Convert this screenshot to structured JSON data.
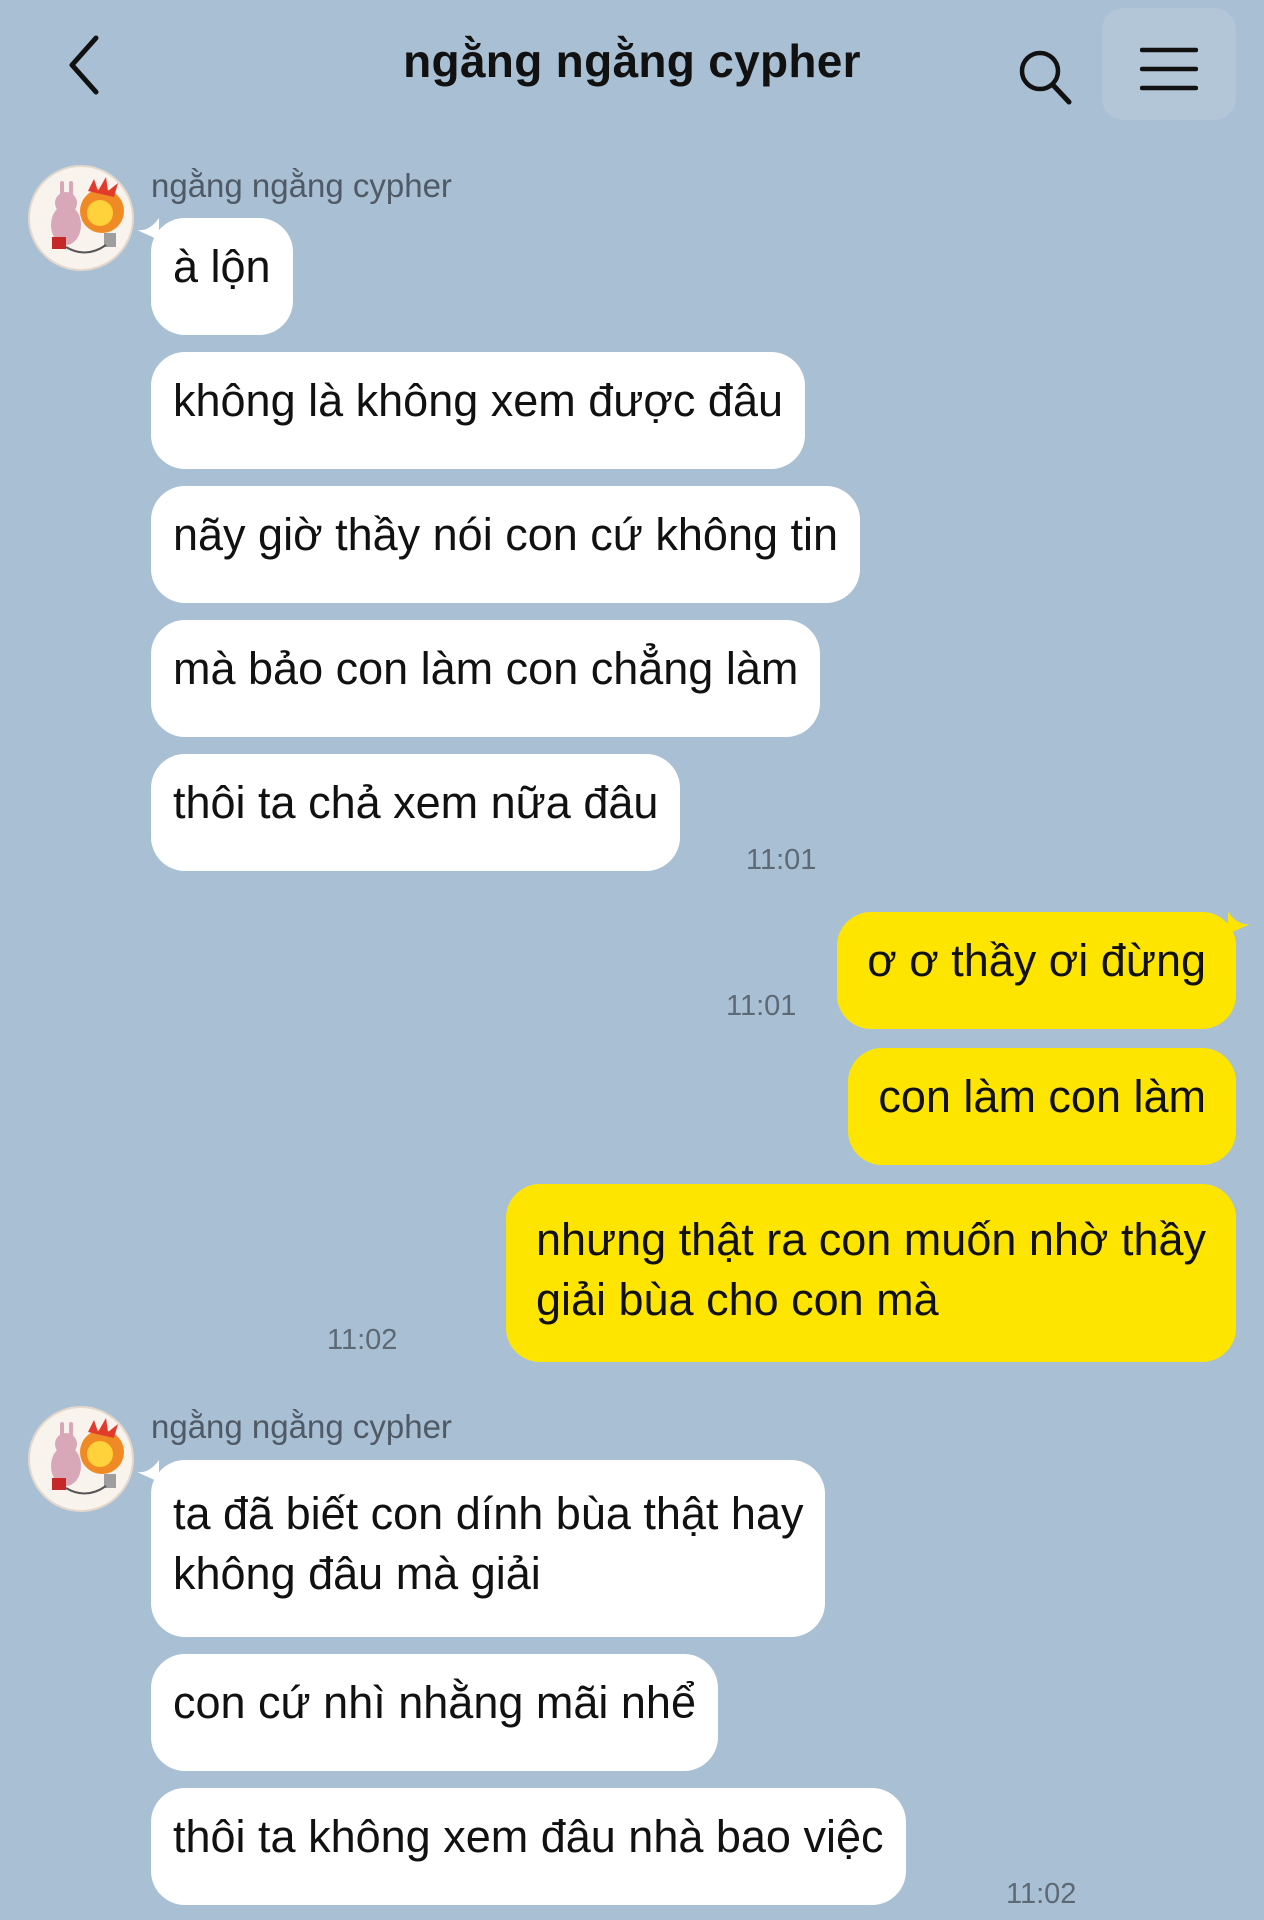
{
  "header": {
    "title": "ngằng ngằng cypher",
    "back_icon": "chevron-left-icon",
    "search_icon": "search-icon",
    "menu_icon": "hamburger-menu-icon"
  },
  "colors": {
    "background": "#a9c0d4",
    "incoming_bubble": "#ffffff",
    "outgoing_bubble": "#fee500"
  },
  "groups": [
    {
      "sender": "ngằng ngằng cypher",
      "messages": [
        "à lộn",
        "không là không xem được đâu",
        "nãy giờ thầy nói con cứ không tin",
        "mà bảo con làm con chẳng làm",
        "thôi ta chả xem nữa đâu"
      ],
      "time": "11:01"
    },
    {
      "sender": "me",
      "messages": [
        {
          "text": "ơ ơ thầy ơi đừng",
          "time": "11:01"
        },
        {
          "text": "con làm con làm"
        },
        {
          "line1": "nhưng thật ra con muốn nhờ thầy",
          "line2": "giải bùa cho con mà",
          "time": "11:02"
        }
      ]
    },
    {
      "sender": "ngằng ngằng cypher",
      "messages": [
        {
          "line1": "ta đã biết con dính bùa thật hay",
          "line2": "không đâu mà giải"
        },
        "con cứ nhì nhằng mãi nhể",
        "thôi ta không xem đâu nhà bao việc"
      ],
      "time": "11:02"
    }
  ]
}
